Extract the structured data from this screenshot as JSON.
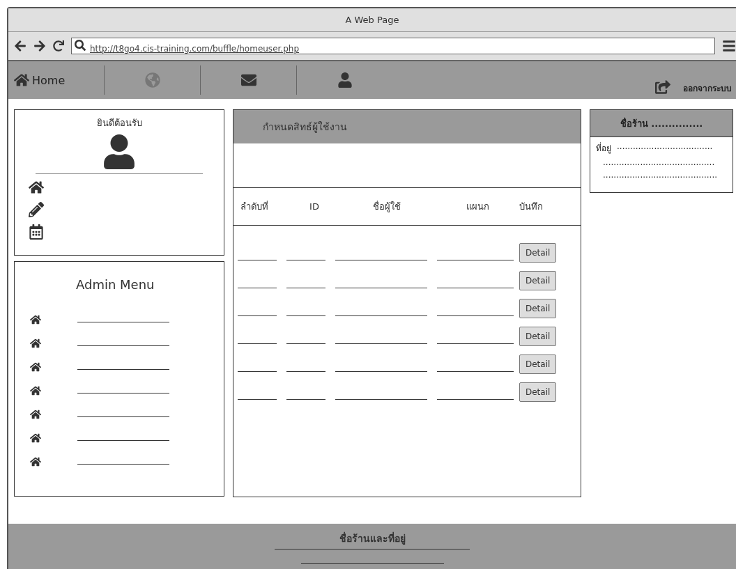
{
  "window": {
    "title": "A Web Page"
  },
  "address_bar": {
    "url": "http://t8go4.cis-training.com/buffle/homeuser.php"
  },
  "nav": {
    "items": [
      {
        "kind": "home",
        "label": "Home",
        "disabled": false
      },
      {
        "kind": "globe",
        "disabled": true
      },
      {
        "kind": "mail",
        "disabled": false
      },
      {
        "kind": "user",
        "disabled": false
      }
    ],
    "logout": "ออกจากระบบ"
  },
  "welcome_card": {
    "title": "ยินดีต้อนรับ",
    "links": [
      {
        "kind": "home"
      },
      {
        "kind": "edit"
      },
      {
        "kind": "calendar"
      }
    ]
  },
  "admin_menu": {
    "title": "Admin Menu",
    "items": [
      {
        "kind": "blank"
      },
      {
        "kind": "blank"
      },
      {
        "kind": "blank"
      },
      {
        "kind": "blank"
      },
      {
        "kind": "blank"
      },
      {
        "kind": "blank"
      },
      {
        "kind": "blank"
      }
    ]
  },
  "permissions_panel": {
    "title": "กำหนดสิทธ์ผู้ใช้งาน",
    "table": {
      "columns": [
        "ลำดับที่",
        "ID",
        "ชื่อผู้ใช้",
        "แผนก",
        "บันทึก"
      ],
      "rows": [
        {
          "button": "Detail"
        },
        {
          "button": "Detail"
        },
        {
          "button": "Detail"
        },
        {
          "button": "Detail"
        },
        {
          "button": "Detail"
        },
        {
          "button": "Detail"
        }
      ]
    }
  },
  "shop_card": {
    "title": "ชื่อร้าน ...............",
    "address_label": "ที่อยู่",
    "address_lines": [
      "....................................",
      "..........................................",
      "..........................................."
    ]
  },
  "footer": {
    "text": "ชื่อร้านและที่อยู่"
  }
}
